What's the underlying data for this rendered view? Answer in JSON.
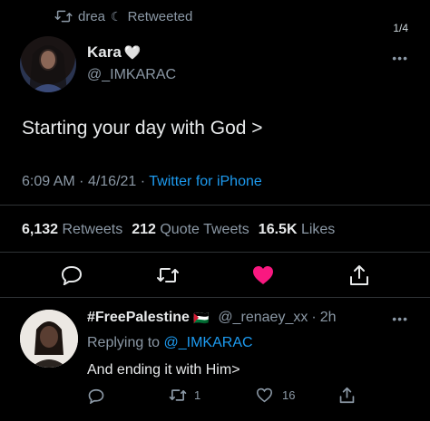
{
  "retweet_banner": {
    "icon": "retweet-icon",
    "user": "drea",
    "moon": "☾",
    "label": "Retweeted"
  },
  "page_counter": "1/4",
  "more": "•••",
  "tweet": {
    "name": "Kara",
    "heart_emoji": "🤍",
    "handle": "@_IMKARAC",
    "text": "Starting your day with God >",
    "time": "6:09 AM",
    "dot1": "·",
    "date": "4/16/21",
    "dot2": "·",
    "source": "Twitter for iPhone",
    "stats": {
      "retweets_count": "6,132",
      "retweets_label": "Retweets",
      "quotes_count": "212",
      "quotes_label": "Quote Tweets",
      "likes_count": "16.5K",
      "likes_label": "Likes"
    },
    "liked": true,
    "like_color": "#f91880"
  },
  "reply": {
    "name": "#FreePalestine",
    "flag": "🇵🇸",
    "handle": "@_renaey_xx",
    "dot": "·",
    "age": "2h",
    "replying_label": "Replying to",
    "replying_handle": "@_IMKARAC",
    "text": "And ending it with Him>",
    "retweet_count": "1",
    "like_count": "16"
  },
  "colors": {
    "accent": "#1d9bf0",
    "background": "#000000",
    "muted": "#8b98a5",
    "like": "#f91880"
  }
}
